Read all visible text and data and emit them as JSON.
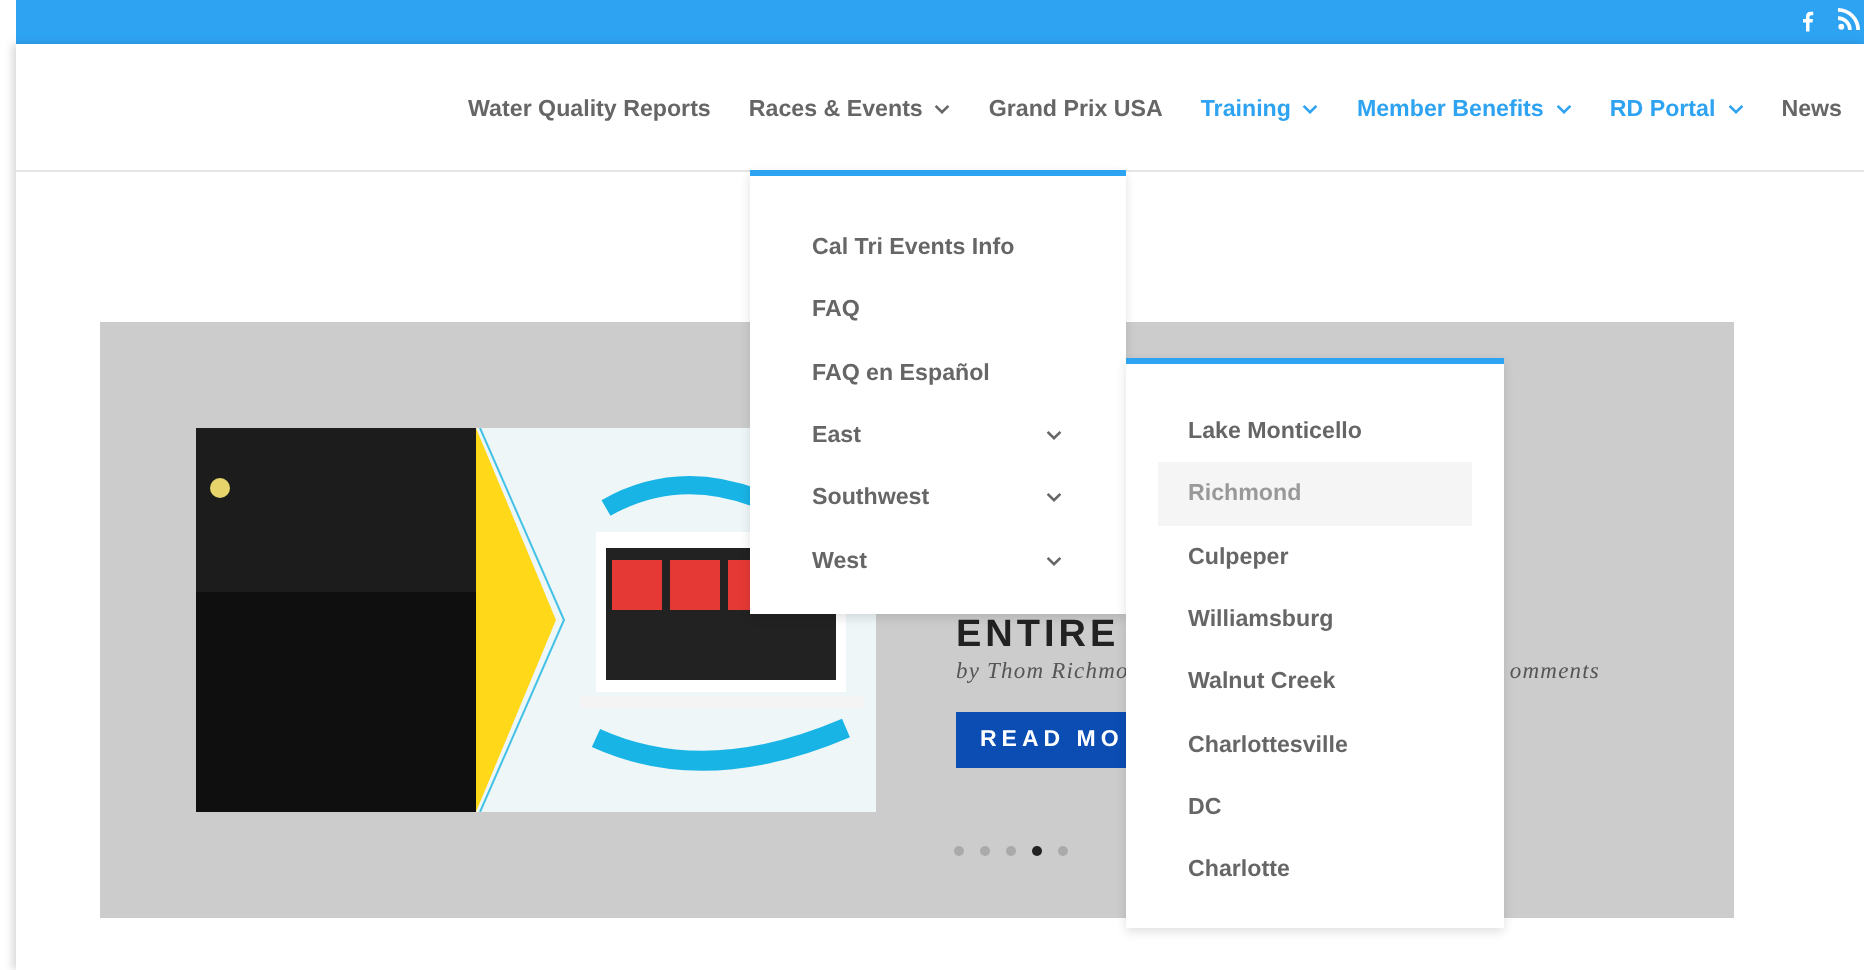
{
  "nav": [
    {
      "label": "Water Quality Reports",
      "has_dropdown": false,
      "color": "#666666"
    },
    {
      "label": "Races & Events",
      "has_dropdown": true,
      "color": "#666666"
    },
    {
      "label": "Grand Prix USA",
      "has_dropdown": false,
      "color": "#666666"
    },
    {
      "label": "Training",
      "has_dropdown": true,
      "color": "#2ea3f2"
    },
    {
      "label": "Member Benefits",
      "has_dropdown": true,
      "color": "#2ea3f2"
    },
    {
      "label": "RD Portal",
      "has_dropdown": true,
      "color": "#2ea3f2"
    },
    {
      "label": "News",
      "has_dropdown": false,
      "color": "#666666"
    }
  ],
  "dropdown": [
    {
      "label": "Cal Tri Events Info",
      "has_submenu": false
    },
    {
      "label": "FAQ",
      "has_submenu": false
    },
    {
      "label": "FAQ en Español",
      "has_submenu": false
    },
    {
      "label": "East",
      "has_submenu": true
    },
    {
      "label": "Southwest",
      "has_submenu": true
    },
    {
      "label": "West",
      "has_submenu": true
    }
  ],
  "submenu": [
    {
      "label": "Lake Monticello",
      "selected": false
    },
    {
      "label": "Richmond",
      "selected": true
    },
    {
      "label": "Culpeper",
      "selected": false
    },
    {
      "label": "Williamsburg",
      "selected": false
    },
    {
      "label": "Walnut Creek",
      "selected": false
    },
    {
      "label": "Charlottesville",
      "selected": false
    },
    {
      "label": "DC",
      "selected": false
    },
    {
      "label": "Charlotte",
      "selected": false
    }
  ],
  "slide": {
    "title": "ENTIRE",
    "byline_left": "by Thom Richmo",
    "byline_right": "omments",
    "button": "READ MO"
  },
  "dots": [
    {
      "selected": false
    },
    {
      "selected": false
    },
    {
      "selected": false
    },
    {
      "selected": true
    },
    {
      "selected": false
    }
  ]
}
